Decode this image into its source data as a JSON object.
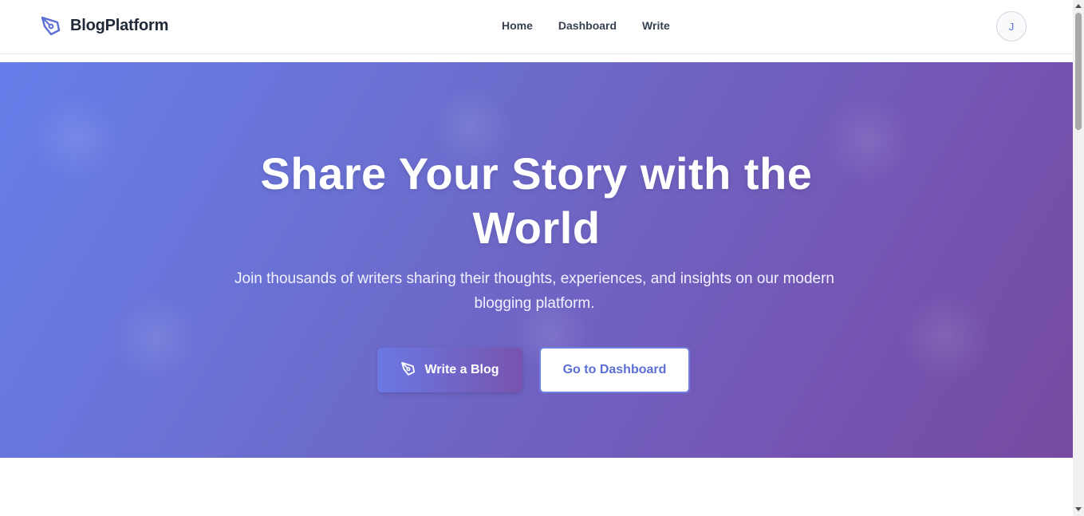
{
  "header": {
    "brand": "BlogPlatform",
    "nav": [
      {
        "label": "Home"
      },
      {
        "label": "Dashboard"
      },
      {
        "label": "Write"
      }
    ],
    "avatar_initial": "J"
  },
  "hero": {
    "title_line1": "Share Your Story with the",
    "title_line2": "World",
    "subtitle": "Join thousands of writers sharing their thoughts, experiences, and insights on our modern blogging platform.",
    "primary_button": "Write a Blog",
    "primary_icon": "pen-nib-icon",
    "secondary_button": "Go to Dashboard"
  },
  "colors": {
    "accent": "#667eea",
    "gradient_end": "#764ba2",
    "text_dark": "#1f2937"
  }
}
